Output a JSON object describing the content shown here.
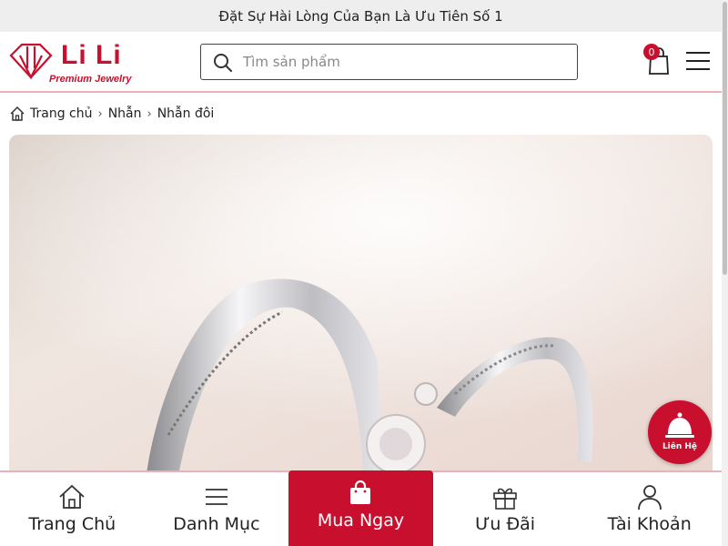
{
  "promo": {
    "text": "Đặt Sự Hài Lòng Của Bạn Là Ưu Tiên Số 1"
  },
  "header": {
    "logo": {
      "brand": "Li Li",
      "tagline": "Premium Jewelry"
    },
    "search": {
      "placeholder": "Tìm sản phẩm"
    },
    "cart": {
      "count": "0"
    },
    "icons": {
      "search": "search-icon",
      "cart": "cart-icon",
      "menu": "hamburger-menu-icon"
    },
    "colors": {
      "brand": "#c8102e",
      "divider": "#e8b3b8"
    }
  },
  "breadcrumb": {
    "items": [
      "Trang chủ",
      "Nhẫn",
      "Nhẫn đôi"
    ]
  },
  "contact": {
    "label": "Liên Hệ"
  },
  "bottom_nav": {
    "items": [
      {
        "label": "Trang Chủ",
        "icon": "home-icon"
      },
      {
        "label": "Danh Mục",
        "icon": "list-icon"
      },
      {
        "label": "Mua Ngay",
        "icon": "shopping-bag-icon"
      },
      {
        "label": "Ưu Đãi",
        "icon": "gift-icon"
      },
      {
        "label": "Tài Khoản",
        "icon": "user-icon"
      }
    ]
  }
}
